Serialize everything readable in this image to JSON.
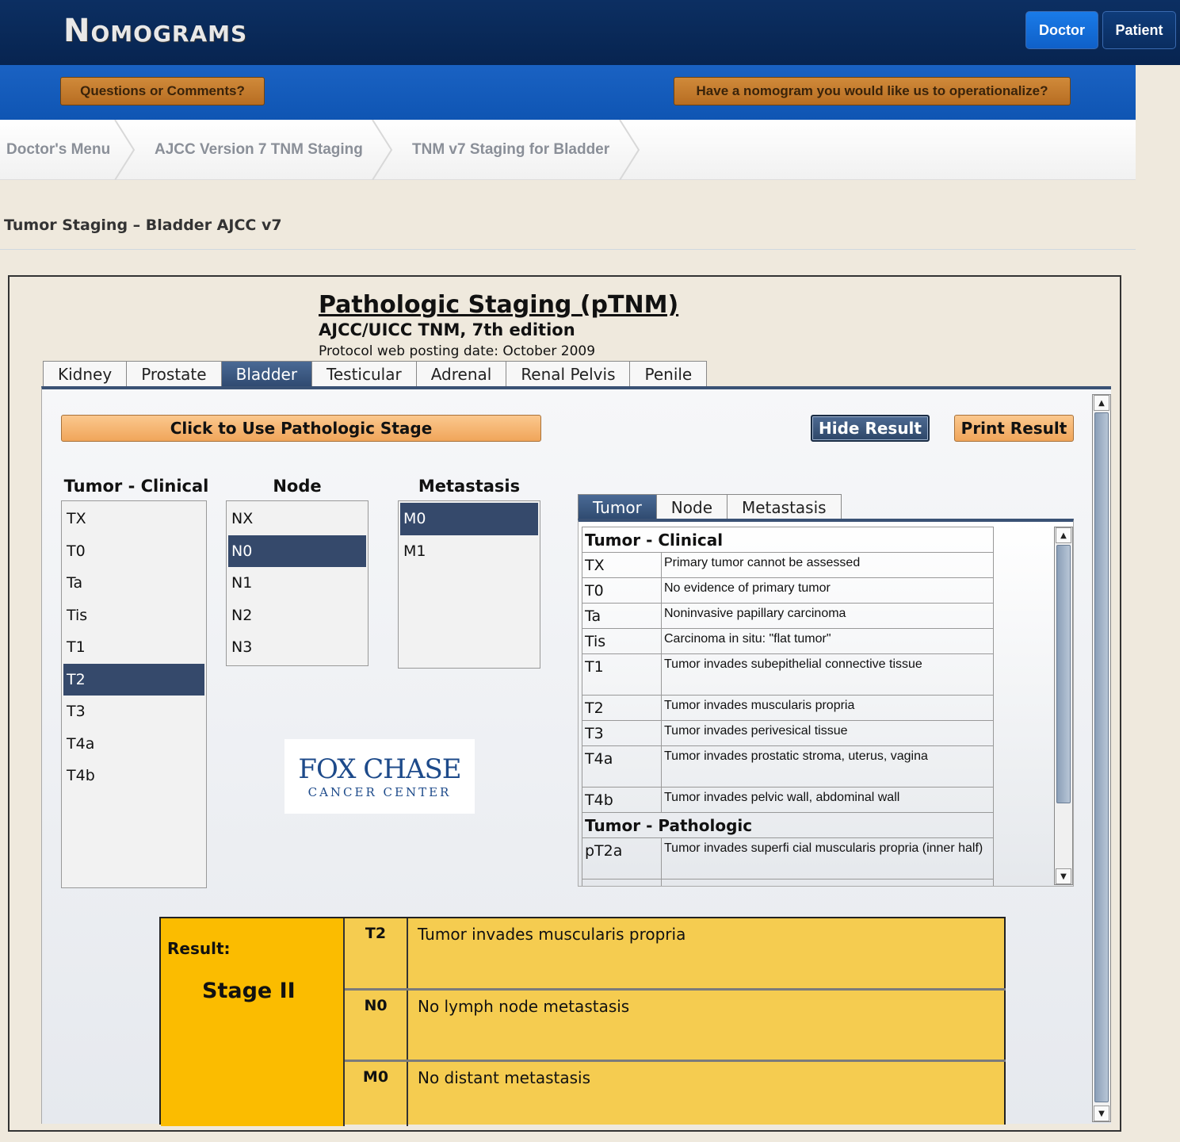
{
  "header": {
    "logo": "Nomograms",
    "doctor_label": "Doctor",
    "patient_label": "Patient"
  },
  "bluebar": {
    "questions_label": "Questions or Comments?",
    "nomogram_label": "Have a nomogram you would like us to operationalize?"
  },
  "breadcrumbs": [
    "Doctor's Menu",
    "AJCC Version 7 TNM Staging",
    "TNM v7 Staging for Bladder"
  ],
  "page_title": "Tumor Staging – Bladder AJCC v7",
  "main": {
    "title": "Pathologic Staging (pTNM)",
    "subtitle": "AJCC/UICC TNM, 7th edition",
    "date": "Protocol web posting date: October 2009",
    "tabs": [
      "Kidney",
      "Prostate",
      "Bladder",
      "Testicular",
      "Adrenal",
      "Renal Pelvis",
      "Penile"
    ],
    "active_tab": "Bladder",
    "use_path_label": "Click to Use Pathologic Stage",
    "hide_label": "Hide Result",
    "print_label": "Print Result"
  },
  "tumor": {
    "header": "Tumor - Clinical",
    "items": [
      "TX",
      "T0",
      "Ta",
      "Tis",
      "T1",
      "T2",
      "T3",
      "T4a",
      "T4b"
    ],
    "selected": "T2"
  },
  "node": {
    "header": "Node",
    "items": [
      "NX",
      "N0",
      "N1",
      "N2",
      "N3"
    ],
    "selected": "N0"
  },
  "metastasis": {
    "header": "Metastasis",
    "items": [
      "M0",
      "M1"
    ],
    "selected": "M0"
  },
  "logo_box": {
    "line1": "FOX CHASE",
    "line2": "CANCER CENTER"
  },
  "definitions": {
    "tabs": [
      "Tumor",
      "Node",
      "Metastasis"
    ],
    "active_tab": "Tumor",
    "clinical_header": "Tumor - Clinical",
    "clinical_rows": [
      {
        "code": "TX",
        "desc": "Primary tumor cannot be assessed"
      },
      {
        "code": "T0",
        "desc": "No evidence of primary tumor"
      },
      {
        "code": "Ta",
        "desc": "Noninvasive papillary carcinoma"
      },
      {
        "code": "Tis",
        "desc": "Carcinoma in situ: \"flat tumor\""
      },
      {
        "code": "T1",
        "desc": "Tumor invades subepithelial connective tissue"
      },
      {
        "code": "T2",
        "desc": "Tumor invades muscularis propria"
      },
      {
        "code": "T3",
        "desc": "Tumor invades perivesical tissue"
      },
      {
        "code": "T4a",
        "desc": "Tumor invades prostatic stroma, uterus, vagina"
      },
      {
        "code": "T4b",
        "desc": "Tumor invades pelvic wall, abdominal wall"
      }
    ],
    "pathologic_header": "Tumor - Pathologic",
    "pathologic_rows": [
      {
        "code": "pT2a",
        "desc": "Tumor invades superfi cial muscularis propria (inner half)"
      }
    ]
  },
  "result": {
    "label": "Result:",
    "stage": "Stage II",
    "rows": [
      {
        "code": "T2",
        "desc": "Tumor invades muscularis propria"
      },
      {
        "code": "N0",
        "desc": "No lymph node metastasis"
      },
      {
        "code": "M0",
        "desc": "No distant metastasis"
      }
    ]
  }
}
